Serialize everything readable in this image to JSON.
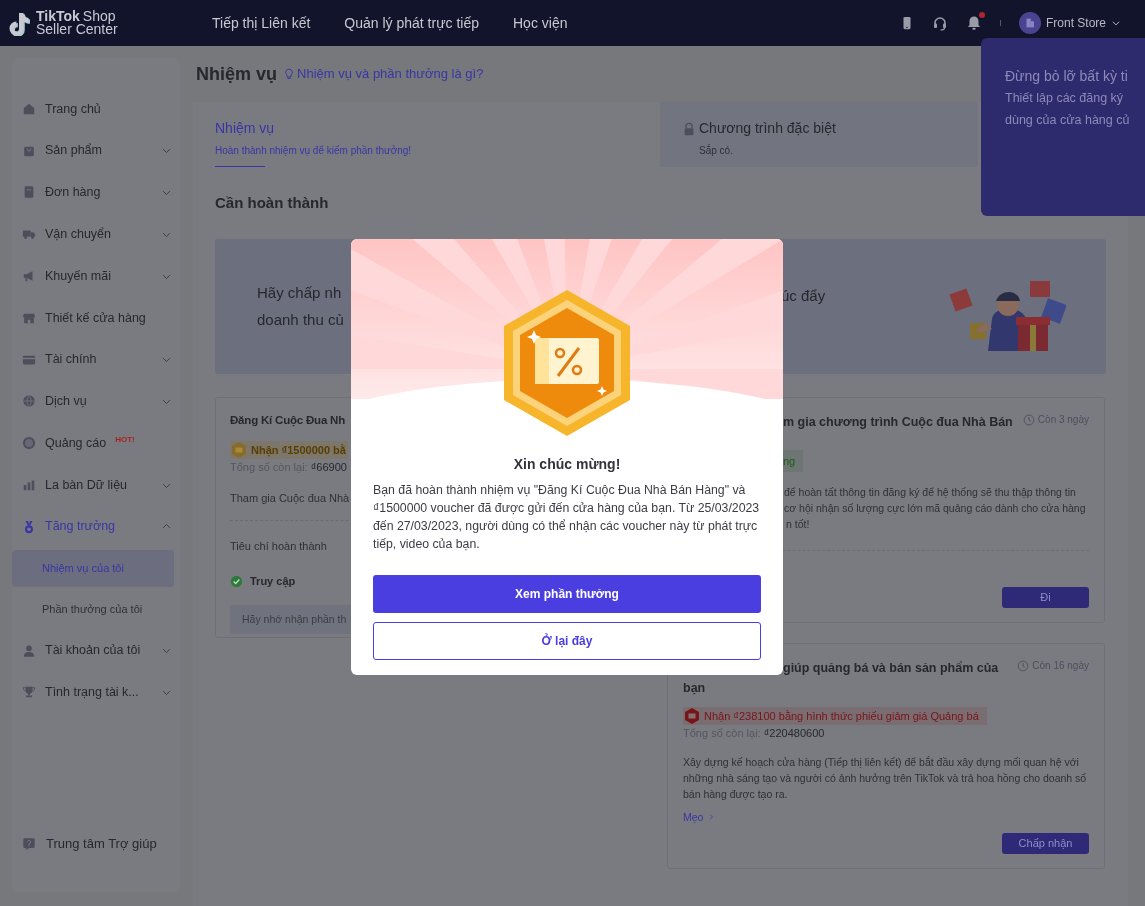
{
  "header": {
    "logo": {
      "brand": "TikTok",
      "product": "Shop",
      "subtitle": "Seller Center"
    },
    "nav": [
      "Tiếp thị Liên kết",
      "Quản lý phát trực tiếp",
      "Học viện"
    ],
    "notifications_unread": true,
    "store": {
      "name": "Front Store"
    }
  },
  "notification_popup": {
    "title": "Đừng bỏ lỡ bất kỳ ti",
    "lines": [
      "Thiết lập các đăng ký",
      "dùng của cửa hàng củ"
    ]
  },
  "sidebar": {
    "items": [
      {
        "label": "Trang chủ",
        "selected": false
      },
      {
        "label": "Sản phẩm",
        "selected": false,
        "expanded": false
      },
      {
        "label": "Đơn hàng",
        "selected": false,
        "expanded": false
      },
      {
        "label": "Vận chuyển",
        "selected": false,
        "expanded": false
      },
      {
        "label": "Khuyến mãi",
        "selected": false,
        "expanded": false
      },
      {
        "label": "Thiết kế cửa hàng",
        "selected": false
      },
      {
        "label": "Tài chính",
        "selected": false,
        "expanded": false
      },
      {
        "label": "Dịch vụ",
        "selected": false,
        "expanded": false
      },
      {
        "label": "Quảng cáo",
        "selected": false,
        "badge": "HOT!"
      },
      {
        "label": "La bàn Dữ liệu",
        "selected": false,
        "expanded": false
      },
      {
        "label": "Tăng trưởng",
        "selected": true,
        "expanded": true,
        "children": [
          {
            "label": "Nhiệm vụ của tôi",
            "selected": true
          },
          {
            "label": "Phần thưởng của tôi",
            "selected": false
          }
        ]
      },
      {
        "label": "Tài khoản của tôi",
        "selected": false,
        "expanded": false
      },
      {
        "label": "Tình trạng tài k...",
        "selected": false,
        "expanded": false
      }
    ],
    "footer": "Trung tâm Trợ giúp"
  },
  "page": {
    "title": "Nhiệm vụ",
    "help_link": "Nhiệm vụ và phần thưởng là gì?"
  },
  "tabs": [
    {
      "title": "Nhiệm vụ",
      "subtitle": "Hoàn thành nhiệm vụ để kiếm phần thưởng!",
      "selected": true,
      "locked": false
    },
    {
      "title": "Chương trình đặc biệt",
      "subtitle": "Sắp có.",
      "selected": false,
      "locked": true
    }
  ],
  "section_title": "Cần hoàn thành",
  "banner": {
    "left_lines": [
      "Hãy chấp nh",
      "doanh thu củ"
    ],
    "right_text": "úc đẩy"
  },
  "task_left": {
    "title": "Đăng Kí Cuộc Đua Nh",
    "reward": {
      "text": "Nhận ₫1500000 bằ",
      "color": "#5a3d00"
    },
    "remaining_label": "Tổng số còn lại:",
    "remaining_value": "₫66900",
    "description": "Tham gia Cuộc đua Nhà",
    "criteria_title": "Tiêu chí hoàn thành",
    "criteria": [
      {
        "label": "Truy cập",
        "done": true
      }
    ],
    "reminder": "Hãy nhớ nhận phần th"
  },
  "task_right": [
    {
      "title_lines": [
        "m gia chương trình Cuộc đua Nhà Bán"
      ],
      "time_left": "Còn 3 ngày",
      "reward": {
        "text": "ng",
        "color": "#1f5a1a"
      },
      "description_lines": [
        "để hoàn tất thông tin đăng ký để hệ thống sẽ thu thập thông tin",
        "cơ hội nhận số lượng cực lớn mã quảng cáo dành cho cửa hàng",
        "n tốt!"
      ],
      "action": "Đi"
    },
    {
      "title_lines": [
        "giúp quảng bá và bán sản phẩm của",
        "bạn"
      ],
      "time_left": "Còn 16 ngày",
      "reward": {
        "text": "Nhận ₫238100 bằng hình thức phiếu giảm giá Quảng bá",
        "color": "#7a1418"
      },
      "remaining_label": "Tổng số còn lại:",
      "remaining_value": "₫220480600",
      "description_lines": [
        "Xây dựng kế hoạch cửa hàng (Tiếp thị liên kết) để bắt đầu xây dựng mối quan hệ với những nhà sáng tạo và người có ảnh hưởng trên TikTok và trả hoa hồng cho doanh số bán hàng được tạo ra."
      ],
      "tips_link": "Mẹo",
      "action": "Chấp nhận"
    }
  ],
  "modal": {
    "title": "Xin chúc mừng!",
    "message": "Bạn đã hoàn thành nhiệm vụ \"Đăng Kí Cuộc Đua Nhà Bán Hàng\" và ₫1500000 voucher đã được gửi đến cửa hàng của bạn. Từ 25/03/2023 đến 27/03/2023, người dùng có thể nhận các voucher này từ phát trực tiếp, video của bạn.",
    "primary_button": "Xem phần thưởng",
    "secondary_button": "Ở lại đây"
  }
}
